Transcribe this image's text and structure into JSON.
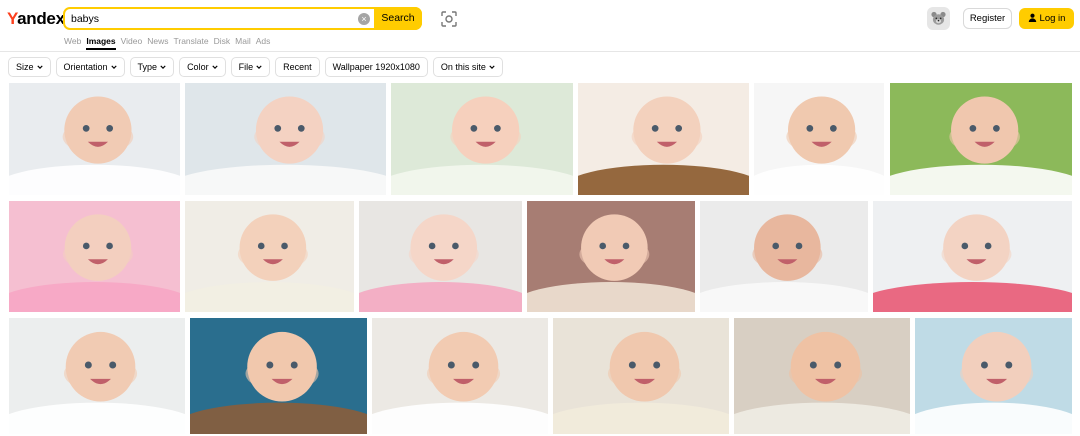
{
  "header": {
    "logo_first": "Y",
    "logo_rest": "andex",
    "search_value": "babys",
    "search_button": "Search",
    "clear_label": "×",
    "tabs": [
      {
        "label": "Web"
      },
      {
        "label": "Images",
        "active": true
      },
      {
        "label": "Video"
      },
      {
        "label": "News"
      },
      {
        "label": "Translate"
      },
      {
        "label": "Disk"
      },
      {
        "label": "Mail"
      },
      {
        "label": "Ads"
      }
    ],
    "register": "Register",
    "login": "Log in"
  },
  "filters": [
    {
      "label": "Size",
      "dropdown": true
    },
    {
      "label": "Orientation",
      "dropdown": true
    },
    {
      "label": "Type",
      "dropdown": true
    },
    {
      "label": "Color",
      "dropdown": true
    },
    {
      "label": "File",
      "dropdown": true
    },
    {
      "label": "Recent",
      "dropdown": false
    },
    {
      "label": "Wallpaper 1920x1080",
      "dropdown": false
    },
    {
      "label": "On this site",
      "dropdown": true
    }
  ],
  "colors": {
    "brand_red": "#fc3f1d",
    "accent_yellow": "#ffcc00"
  },
  "icons": {
    "camera": "camera-search-icon",
    "avatar": "bear-avatar-icon",
    "user": "user-icon"
  },
  "results": [
    {
      "name": "baby-on-blanket",
      "bg": "#e9ecef",
      "face": "#f1cbb4",
      "accent": "#ffffff"
    },
    {
      "name": "baby-under-white-towel",
      "bg": "#dfe6ea",
      "face": "#f4d2c2",
      "accent": "#fafafa"
    },
    {
      "name": "laughing-baby-hood",
      "bg": "#dde9d8",
      "face": "#f6d0bd",
      "accent": "#f3f7ee"
    },
    {
      "name": "baby-with-teddy-bears",
      "bg": "#f4ece4",
      "face": "#f3d1bd",
      "accent": "#8b5a2b"
    },
    {
      "name": "smiling-baby-white",
      "bg": "#f6f6f6",
      "face": "#f0c9af",
      "accent": "#ffffff"
    },
    {
      "name": "baby-green-background",
      "bg": "#8cb95a",
      "face": "#f0c7ae",
      "accent": "#ffffff"
    },
    {
      "name": "sleeping-baby-pink-hat",
      "bg": "#f5bfd1",
      "face": "#f3cfbf",
      "accent": "#f7a6c4"
    },
    {
      "name": "baby-knit-hat",
      "bg": "#f0ede6",
      "face": "#f3d1bb",
      "accent": "#f2eee2"
    },
    {
      "name": "baby-flower-headband",
      "bg": "#e8e6e3",
      "face": "#f5d6c8",
      "accent": "#f4a9c1"
    },
    {
      "name": "baby-bonnet-brown",
      "bg": "#a77d73",
      "face": "#f1cab5",
      "accent": "#efe2d4"
    },
    {
      "name": "newborn-white-hood",
      "bg": "#ebebeb",
      "face": "#e8b79e",
      "accent": "#fafafa"
    },
    {
      "name": "baby-polka-dots",
      "bg": "#eef0f2",
      "face": "#f3d3c3",
      "accent": "#e85a76"
    },
    {
      "name": "two-babies",
      "bg": "#eceeee",
      "face": "#f1cbb3",
      "accent": "#ffffff"
    },
    {
      "name": "baby-blue-teddy",
      "bg": "#2a6e8e",
      "face": "#f1c8ad",
      "accent": "#8a5d3b"
    },
    {
      "name": "baby-crawling-bear",
      "bg": "#ece9e4",
      "face": "#f2cbb2",
      "accent": "#ffffff"
    },
    {
      "name": "baby-puppy-toy",
      "bg": "#e9e3d8",
      "face": "#f0c8ae",
      "accent": "#f2ebdc"
    },
    {
      "name": "baby-striped-hat",
      "bg": "#d8cfc3",
      "face": "#efc2a4",
      "accent": "#f0ece4"
    },
    {
      "name": "baby-tongue-out",
      "bg": "#bfdbe6",
      "face": "#f2cfbd",
      "accent": "#ffffff"
    }
  ]
}
